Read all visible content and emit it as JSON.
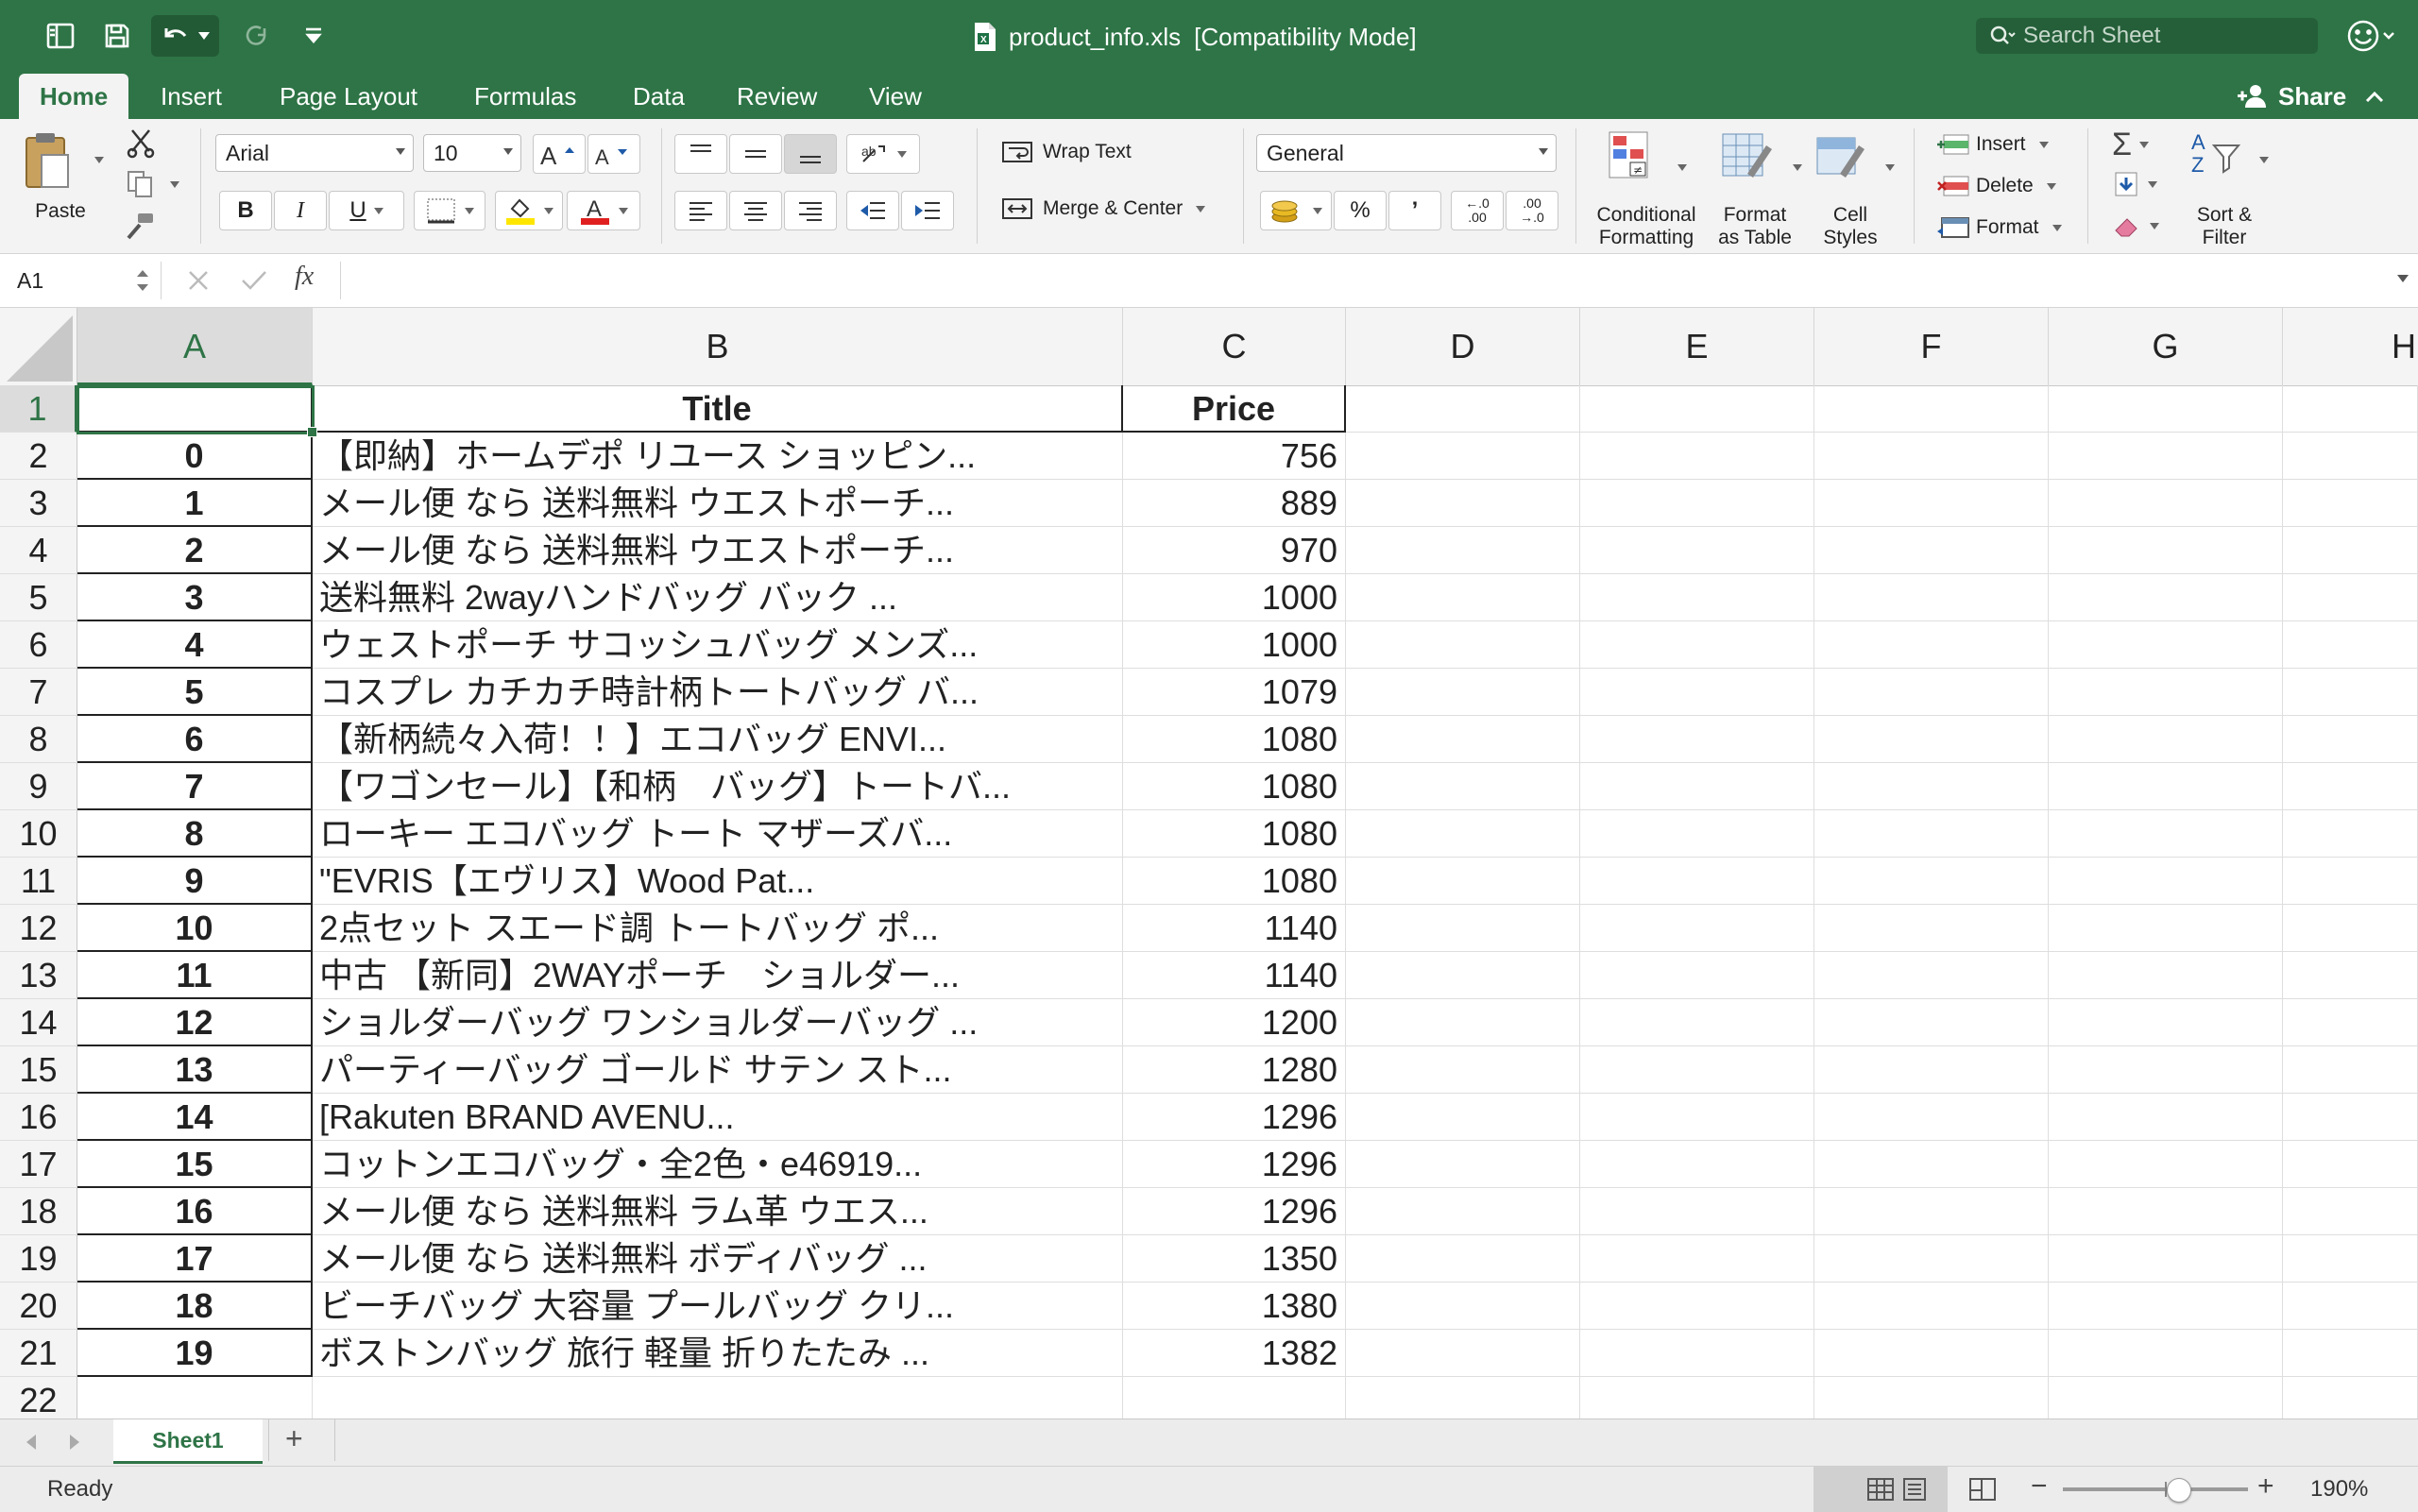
{
  "app": {
    "file_name": "product_info.xls",
    "mode": "[Compatibility Mode]",
    "search_placeholder": "Search Sheet"
  },
  "tabs": [
    "Home",
    "Insert",
    "Page Layout",
    "Formulas",
    "Data",
    "Review",
    "View"
  ],
  "share_label": "Share",
  "ribbon": {
    "paste": "Paste",
    "font_name": "Arial",
    "font_size": "10",
    "bold": "B",
    "italic": "I",
    "underline": "U",
    "wrap_text": "Wrap Text",
    "merge_center": "Merge & Center",
    "number_format": "General",
    "percent": "%",
    "comma": "’",
    "cond_format_1": "Conditional",
    "cond_format_2": "Formatting",
    "format_table_1": "Format",
    "format_table_2": "as Table",
    "cell_styles_1": "Cell",
    "cell_styles_2": "Styles",
    "insert": "Insert",
    "delete": "Delete",
    "format": "Format",
    "sort_filter_1": "Sort &",
    "sort_filter_2": "Filter",
    "inc_decimal_top": "←.0",
    "inc_decimal_bottom": ".00",
    "dec_decimal_top": ".00",
    "dec_decimal_bottom": "→.0"
  },
  "formula_bar": {
    "name_box": "A1",
    "fx": "fx",
    "content": ""
  },
  "columns": [
    "A",
    "B",
    "C",
    "D",
    "E",
    "F",
    "G",
    "H"
  ],
  "header_row": {
    "row_num": "1",
    "A": "",
    "B": "Title",
    "C": "Price"
  },
  "rows": [
    {
      "row_num": "2",
      "A": "0",
      "B": "【即納】ホームデポ リユース ショッピン...",
      "C": "756"
    },
    {
      "row_num": "3",
      "A": "1",
      "B": "メール便 なら 送料無料 ウエストポーチ...",
      "C": "889"
    },
    {
      "row_num": "4",
      "A": "2",
      "B": "メール便 なら 送料無料 ウエストポーチ...",
      "C": "970"
    },
    {
      "row_num": "5",
      "A": "3",
      "B": "送料無料 2wayハンドバッグ バック ...",
      "C": "1000"
    },
    {
      "row_num": "6",
      "A": "4",
      "B": "ウェストポーチ サコッシュバッグ メンズ...",
      "C": "1000"
    },
    {
      "row_num": "7",
      "A": "5",
      "B": "コスプレ カチカチ時計柄トートバッグ バ...",
      "C": "1079"
    },
    {
      "row_num": "8",
      "A": "6",
      "B": "【新柄続々入荷！！】エコバッグ ENVI...",
      "C": "1080"
    },
    {
      "row_num": "9",
      "A": "7",
      "B": "【ワゴンセール】【和柄　バッグ】トートバ...",
      "C": "1080"
    },
    {
      "row_num": "10",
      "A": "8",
      "B": "ローキー エコバッグ トート マザーズバ...",
      "C": "1080"
    },
    {
      "row_num": "11",
      "A": "9",
      "B": "\"EVRIS【エヴリス】Wood Pat...",
      "C": "1080"
    },
    {
      "row_num": "12",
      "A": "10",
      "B": "2点セット スエード調 トートバッグ ポ...",
      "C": "1140"
    },
    {
      "row_num": "13",
      "A": "11",
      "B": "中古 【新同】2WAYポーチ　ショルダー...",
      "C": "1140"
    },
    {
      "row_num": "14",
      "A": "12",
      "B": "ショルダーバッグ ワンショルダーバッグ ...",
      "C": "1200"
    },
    {
      "row_num": "15",
      "A": "13",
      "B": "パーティーバッグ ゴールド サテン スト...",
      "C": "1280"
    },
    {
      "row_num": "16",
      "A": "14",
      "B": "[Rakuten BRAND AVENU...",
      "C": "1296"
    },
    {
      "row_num": "17",
      "A": "15",
      "B": "コットンエコバッグ・全2色・e46919...",
      "C": "1296"
    },
    {
      "row_num": "18",
      "A": "16",
      "B": "メール便 なら 送料無料 ラム革 ウエス...",
      "C": "1296"
    },
    {
      "row_num": "19",
      "A": "17",
      "B": "メール便 なら 送料無料 ボディバッグ ...",
      "C": "1350"
    },
    {
      "row_num": "20",
      "A": "18",
      "B": "ビーチバッグ 大容量 プールバッグ クリ...",
      "C": "1380"
    },
    {
      "row_num": "21",
      "A": "19",
      "B": "ボストンバッグ 旅行 軽量 折りたたみ ...",
      "C": "1382"
    }
  ],
  "empty_row": {
    "row_num": "22"
  },
  "sheet_tabs": [
    "Sheet1"
  ],
  "add_sheet": "+",
  "status": {
    "text": "Ready",
    "zoom": "190%",
    "zoom_out": "−",
    "zoom_in": "+"
  },
  "colors": {
    "brand_green": "#2e7446",
    "ribbon_bg": "#f3f3f3",
    "font_color_red": "#e02020",
    "highlight_yellow": "#ffe600"
  }
}
